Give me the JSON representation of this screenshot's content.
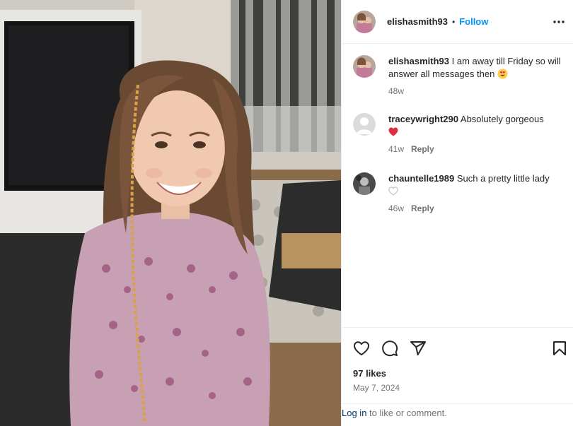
{
  "colors": {
    "text": "#262626",
    "muted": "#737373",
    "follow": "#0095f6",
    "link": "#00376b",
    "border": "#efefef",
    "heart": "#ff3040"
  },
  "photo": {
    "icon": "photo-of-smiling-girl"
  },
  "header": {
    "username": "elishasmith93",
    "dot": "•",
    "follow_label": "Follow",
    "more_icon": "more-dots-icon"
  },
  "comments": [
    {
      "username": "elishasmith93",
      "text": "I am away till Friday so will answer all messages then",
      "emoji": "heart-eyes-emoji",
      "time": "48w",
      "reply_label": ""
    },
    {
      "username": "traceywright290",
      "text": "Absolutely gorgeous",
      "emoji": "red-heart-emoji",
      "time": "41w",
      "reply_label": "Reply"
    },
    {
      "username": "chauntelle1989",
      "text": "Such a pretty little lady",
      "emoji": "",
      "time": "46w",
      "reply_label": "Reply"
    }
  ],
  "actions": {
    "like_icon": "heart-outline-icon",
    "comment_icon": "comment-bubble-icon",
    "share_icon": "paper-plane-icon",
    "save_icon": "bookmark-icon",
    "likes": "97 likes",
    "date": "May 7, 2024"
  },
  "login": {
    "link_label": "Log in",
    "rest": " to like or comment."
  }
}
